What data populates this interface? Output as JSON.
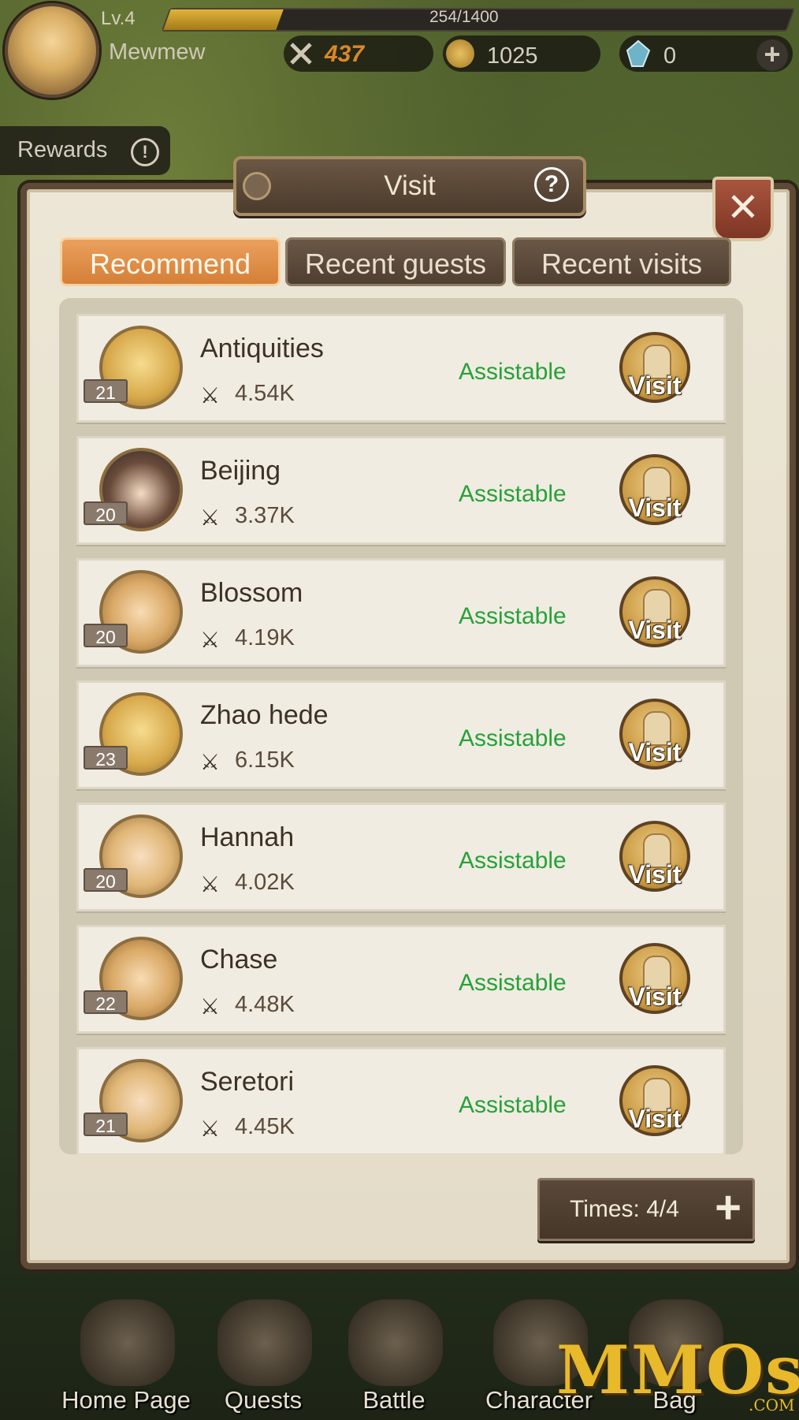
{
  "header": {
    "level": "Lv.4",
    "xp_text": "254/1400",
    "xp_fraction": 0.181,
    "player_name": "Mewmew",
    "power": "437",
    "gold": "1025",
    "gems": "0",
    "plus_label": "+"
  },
  "rewards": {
    "label": "Rewards",
    "info_icon": "!"
  },
  "dialog": {
    "title": "Visit",
    "help_icon": "?",
    "close_icon": "✕",
    "tabs": [
      {
        "label": "Recommend",
        "active": true
      },
      {
        "label": "Recent guests",
        "active": false
      },
      {
        "label": "Recent visits",
        "active": false
      }
    ],
    "rows": [
      {
        "level": "21",
        "name": "Antiquities",
        "power": "4.54K",
        "status": "Assistable",
        "button": "Visit"
      },
      {
        "level": "20",
        "name": "Beijing",
        "power": "3.37K",
        "status": "Assistable",
        "button": "Visit"
      },
      {
        "level": "20",
        "name": "Blossom",
        "power": "4.19K",
        "status": "Assistable",
        "button": "Visit"
      },
      {
        "level": "23",
        "name": "Zhao hede",
        "power": "6.15K",
        "status": "Assistable",
        "button": "Visit"
      },
      {
        "level": "20",
        "name": "Hannah",
        "power": "4.02K",
        "status": "Assistable",
        "button": "Visit"
      },
      {
        "level": "22",
        "name": "Chase",
        "power": "4.48K",
        "status": "Assistable",
        "button": "Visit"
      },
      {
        "level": "21",
        "name": "Seretori",
        "power": "4.45K",
        "status": "Assistable",
        "button": "Visit"
      }
    ],
    "times_label": "Times: 4/4",
    "times_plus": "+"
  },
  "nav": [
    {
      "label": "Home Page"
    },
    {
      "label": "Quests"
    },
    {
      "label": "Battle"
    },
    {
      "label": "Character"
    },
    {
      "label": "Bag"
    }
  ],
  "watermark": {
    "text": "MMOs",
    "suffix": ".COM"
  },
  "colors": {
    "status_green": "#27a13a",
    "tab_active": "#d57f38",
    "tab_inactive": "#4f3f31",
    "power_orange": "#d8882a"
  },
  "icons": {
    "power": "crossed-swords-icon",
    "gold": "coin-icon",
    "gem": "crystal-icon",
    "visit": "person-enter-icon"
  }
}
